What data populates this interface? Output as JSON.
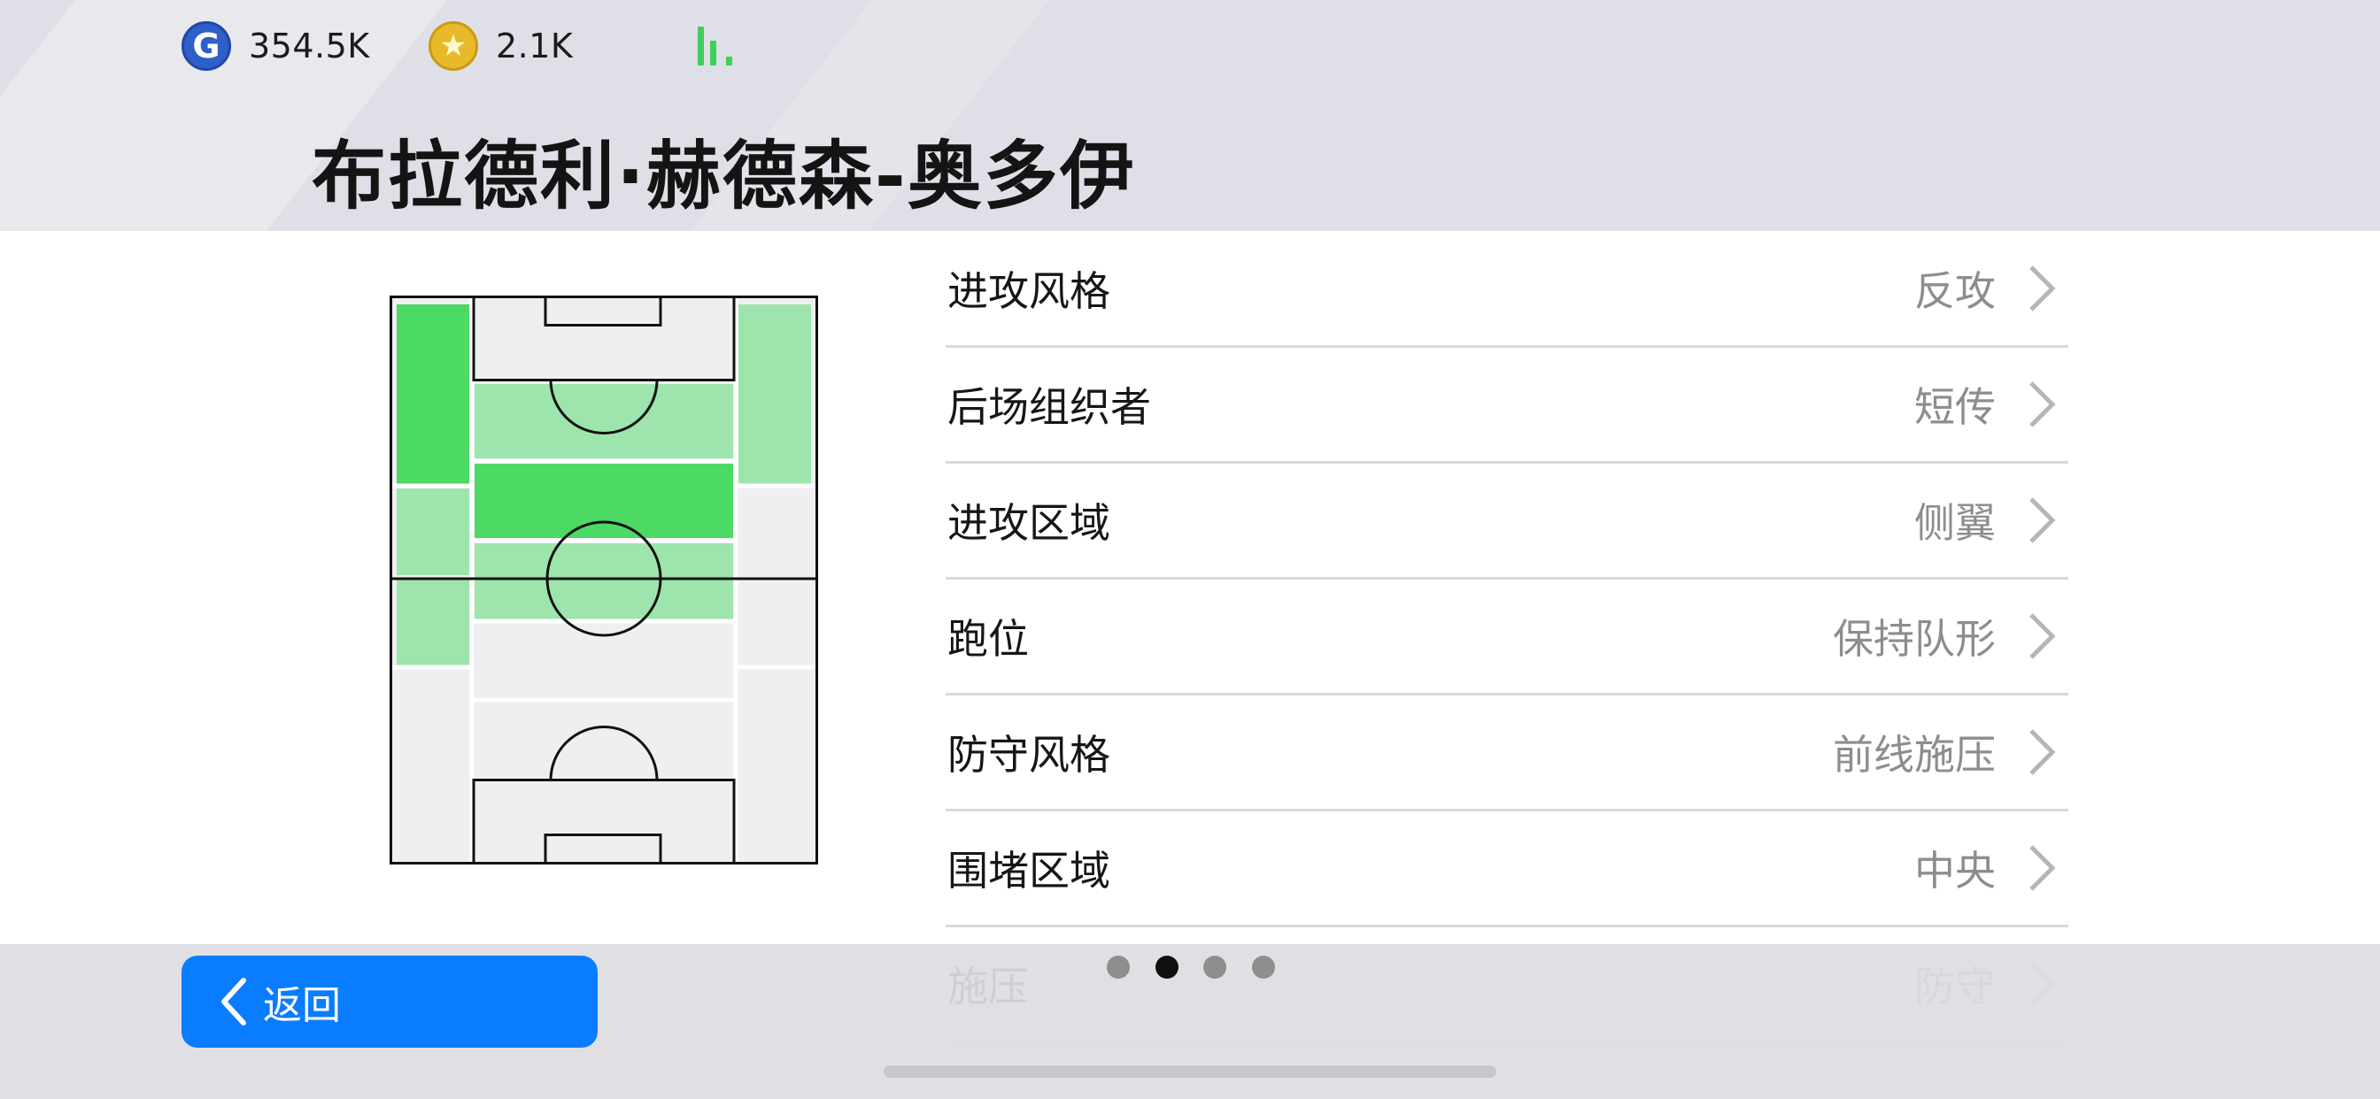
{
  "header": {
    "currencies": [
      {
        "icon": "gp-coin-icon",
        "glyph": "G",
        "value": "354.5K"
      },
      {
        "icon": "star-coin-icon",
        "glyph": "★",
        "value": "2.1K"
      }
    ],
    "signal_icon": "signal-bars-icon",
    "player_name": "布拉德利·赫德森-奥多伊"
  },
  "pitch": {
    "icon": "pitch-map",
    "zone_colors": {
      "strong": "#4cd964",
      "medium": "#9de5ad",
      "none": "#efeff1"
    }
  },
  "settings": [
    {
      "label": "进攻风格",
      "value": "反攻"
    },
    {
      "label": "后场组织者",
      "value": "短传"
    },
    {
      "label": "进攻区域",
      "value": "侧翼"
    },
    {
      "label": "跑位",
      "value": "保持队形"
    },
    {
      "label": "防守风格",
      "value": "前线施压"
    },
    {
      "label": "围堵区域",
      "value": "中央"
    },
    {
      "label": "施压",
      "value": "防守"
    }
  ],
  "footer": {
    "back_label": "返回",
    "page_indicator": {
      "total": 4,
      "active": 2
    }
  },
  "colors": {
    "accent": "#0a7cff",
    "header_bg": "#dfe0e7",
    "value_text": "#8d8d8d"
  }
}
